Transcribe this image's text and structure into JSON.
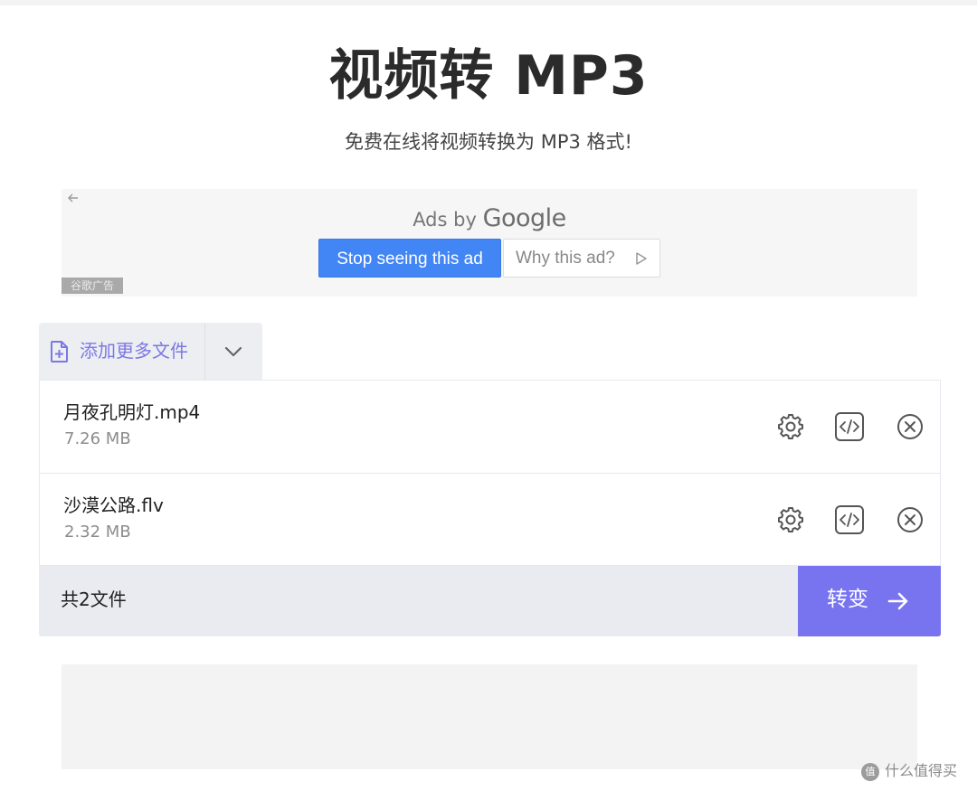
{
  "header": {
    "title": "视频转 MP3",
    "subtitle": "免费在线将视频转换为 MP3 格式!"
  },
  "ad": {
    "back_icon": "arrow-left-icon",
    "ads_by": "Ads by",
    "google": "Google",
    "stop_label": "Stop seeing this ad",
    "why_label": "Why this ad?",
    "tag": "谷歌广告"
  },
  "add_files": {
    "label": "添加更多文件",
    "icon": "file-plus-icon",
    "toggle_icon": "chevron-down-icon"
  },
  "files": [
    {
      "name": "月夜孔明灯.mp4",
      "size": "7.26 MB"
    },
    {
      "name": "沙漠公路.flv",
      "size": "2.32 MB"
    }
  ],
  "footer": {
    "count": "共2文件",
    "convert_label": "转变"
  },
  "watermark": {
    "logo": "值",
    "text": "什么值得买"
  },
  "colors": {
    "accent": "#7874f0",
    "ad_button": "#4285f4",
    "add_label": "#7b78e2"
  }
}
